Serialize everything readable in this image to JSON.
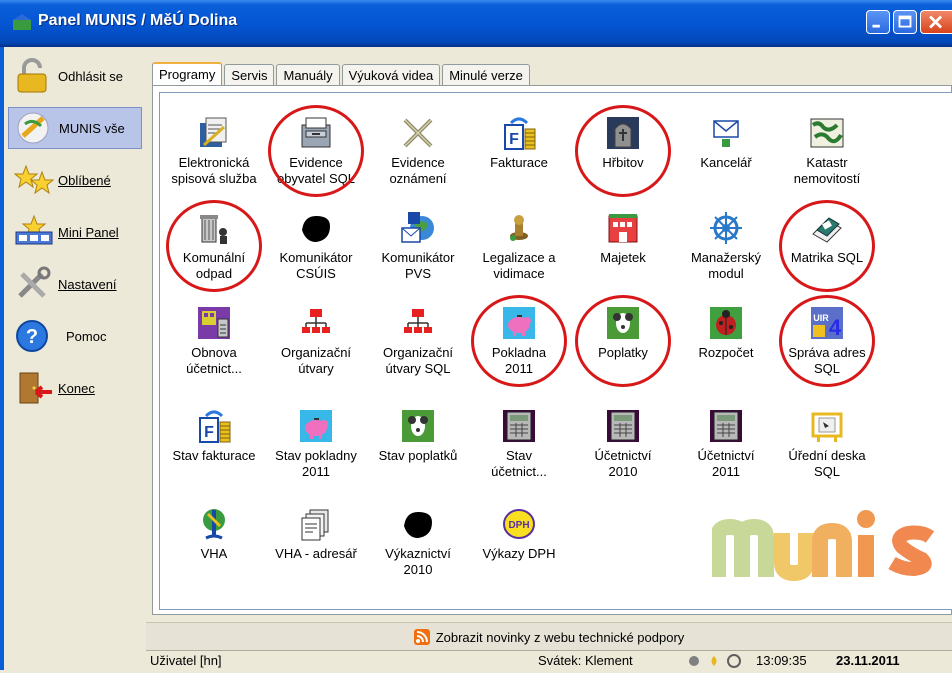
{
  "window": {
    "title": "Panel MUNIS / MěÚ Dolina"
  },
  "sidebar": {
    "items": [
      {
        "label": "Odhlásit se",
        "icon": "padlock-icon"
      },
      {
        "label": "MUNIS vše",
        "icon": "munis-icon"
      },
      {
        "label": "Oblíbené",
        "icon": "stars-icon"
      },
      {
        "label": "Mini Panel",
        "icon": "mini-panel-icon"
      },
      {
        "label": "Nastavení",
        "icon": "tools-icon"
      },
      {
        "label": "Pomoc",
        "icon": "help-icon"
      },
      {
        "label": "Konec",
        "icon": "exit-door-icon"
      }
    ]
  },
  "tabs": [
    {
      "label": "Programy"
    },
    {
      "label": "Servis"
    },
    {
      "label": "Manuály"
    },
    {
      "label": "Výuková videa"
    },
    {
      "label": "Minulé verze"
    }
  ],
  "apps": [
    {
      "label": "Elektronická\nspisová služba",
      "icon": "document-folder-icon"
    },
    {
      "label": "Evidence\nobyvatel SQL",
      "icon": "file-cabinet-icon",
      "circled": true
    },
    {
      "label": "Evidence\noznámení",
      "icon": "crossed-swords-icon"
    },
    {
      "label": "Fakturace",
      "icon": "invoice-icon"
    },
    {
      "label": "Hřbitov",
      "icon": "tombstone-icon",
      "circled": true
    },
    {
      "label": "Kancelář",
      "icon": "envelope-icon"
    },
    {
      "label": "Katastr\nnemovitostí",
      "icon": "map-icon"
    },
    {
      "label": "Komunální\nodpad",
      "icon": "trash-bin-icon",
      "circled": true
    },
    {
      "label": "Komunikátor\nCSÚIS",
      "icon": "black-blob-icon"
    },
    {
      "label": "Komunikátor\nPVS",
      "icon": "globe-mail-icon"
    },
    {
      "label": "Legalizace a\nvidimace",
      "icon": "stamp-icon"
    },
    {
      "label": "Majetek",
      "icon": "building-icon"
    },
    {
      "label": "Manažerský\nmodul",
      "icon": "ship-wheel-icon"
    },
    {
      "label": "Matrika SQL",
      "icon": "book-icon",
      "circled": true
    },
    {
      "label": "Obnova\núčetnict...",
      "icon": "calculator-grid-icon"
    },
    {
      "label": "Organizační\nútvary",
      "icon": "org-chart-icon"
    },
    {
      "label": "Organizační\nútvary SQL",
      "icon": "org-chart-icon"
    },
    {
      "label": "Pokladna\n2011",
      "icon": "piggy-bank-icon",
      "circled": true
    },
    {
      "label": "Poplatky",
      "icon": "dog-icon",
      "circled": true
    },
    {
      "label": "Rozpočet",
      "icon": "ladybug-icon"
    },
    {
      "label": "Správa adres\nSQL",
      "icon": "address-icon",
      "circled": true
    },
    {
      "label": "Stav fakturace",
      "icon": "invoice-icon"
    },
    {
      "label": "Stav pokladny\n2011",
      "icon": "piggy-bank-icon"
    },
    {
      "label": "Stav poplatků",
      "icon": "dog-icon"
    },
    {
      "label": "Stav\núčetnict...",
      "icon": "calculator-icon"
    },
    {
      "label": "Účetnictví\n2010",
      "icon": "calculator-icon"
    },
    {
      "label": "Účetnictví\n2011",
      "icon": "calculator-icon"
    },
    {
      "label": "Úřední deska\nSQL",
      "icon": "notice-board-icon"
    },
    {
      "label": "VHA",
      "icon": "water-meter-icon"
    },
    {
      "label": "VHA - adresář",
      "icon": "cards-icon"
    },
    {
      "label": "Výkaznictví\n2010",
      "icon": "black-blob-icon"
    },
    {
      "label": "Výkazy DPH",
      "icon": "dph-icon"
    }
  ],
  "logo": {
    "text": "munis"
  },
  "news": {
    "label": "Zobrazit novinky z webu technické podpory"
  },
  "status": {
    "user": "Uživatel [hn]",
    "nameday": "Svátek: Klement",
    "time": "13:09:35",
    "date": "23.11.2011"
  },
  "colors": {
    "ring": "#d81818",
    "titlebar": "#0556d4"
  }
}
